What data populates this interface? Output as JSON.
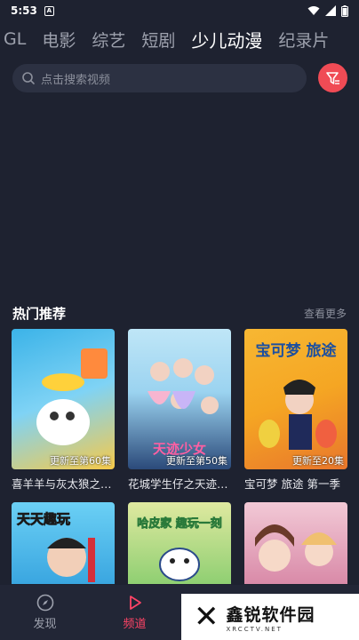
{
  "status": {
    "time": "5:53",
    "badge": "A"
  },
  "tabs": [
    {
      "label": "GL"
    },
    {
      "label": "电影"
    },
    {
      "label": "综艺"
    },
    {
      "label": "短剧"
    },
    {
      "label": "少儿动漫",
      "active": true
    },
    {
      "label": "纪录片"
    }
  ],
  "search": {
    "placeholder": "点击搜索视频"
  },
  "section": {
    "title": "热门推荐",
    "more": "查看更多"
  },
  "cards": [
    {
      "title": "喜羊羊与灰太狼之…",
      "episode": "更新至第60集",
      "poster_text": "7.6",
      "colors": [
        "#3bb3e8",
        "#f7c948"
      ]
    },
    {
      "title": "花城学生仔之天迹…",
      "episode": "更新至第50集",
      "poster_text": "天迹少女",
      "colors": [
        "#9bd3f0",
        "#2b4a7a"
      ]
    },
    {
      "title": "宝可梦 旅途 第一季",
      "episode": "更新至20集",
      "poster_text": "宝可梦 旅途",
      "colors": [
        "#f5a623",
        "#e8762c"
      ]
    },
    {
      "title": "",
      "episode": "",
      "poster_text": "天天趣玩",
      "colors": [
        "#6bd0f5",
        "#3aa6e0"
      ]
    },
    {
      "title": "",
      "episode": "",
      "poster_text": "哈皮家 趣玩一刻",
      "colors": [
        "#dfe9a0",
        "#8fcf72"
      ]
    },
    {
      "title": "",
      "episode": "",
      "poster_text": "",
      "colors": [
        "#f2c9d6",
        "#d98aa8"
      ]
    }
  ],
  "nav": [
    {
      "label": "发现",
      "icon": "compass-icon"
    },
    {
      "label": "频道",
      "icon": "play-icon",
      "active": true
    },
    {
      "label": "",
      "icon": ""
    },
    {
      "label": "",
      "icon": ""
    }
  ],
  "watermark": {
    "name": "鑫锐软件园",
    "url": "XRCCTV.NET"
  },
  "colors": {
    "background": "#1e2230",
    "accent": "#ff4466",
    "filter": "#f04b55"
  }
}
